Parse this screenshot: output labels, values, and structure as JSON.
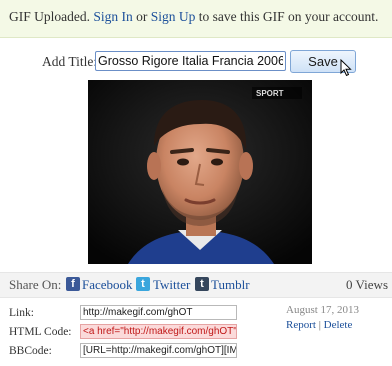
{
  "notice": {
    "status": "GIF Uploaded.",
    "sign_in": "Sign In",
    "or": "or",
    "sign_up": "Sign Up",
    "suffix": "to save this GIF on your account."
  },
  "title_form": {
    "label": "Add Title:",
    "value": "Grosso Rigore Italia Francia 2006",
    "save_label": "Save"
  },
  "gif": {
    "overlay": "SPORT"
  },
  "share": {
    "label": "Share On:",
    "facebook": "Facebook",
    "twitter": "Twitter",
    "tumblr": "Tumblr",
    "views": "0 Views"
  },
  "links": {
    "link_label": "Link:",
    "link_value": "http://makegif.com/ghOT",
    "html_label": "HTML Code:",
    "html_value": "<a href=\"http://makegif.com/ghOT\"><img src=\"http://makegif.com/ghOT.gif\" /></a>",
    "bb_label": "BBCode:",
    "bb_value": "[URL=http://makegif.com/ghOT][IMG]http://makegif.com/ghOT.gif[/IMG][/URL]"
  },
  "meta": {
    "date": "August 17, 2013",
    "report": "Report",
    "separator": "|",
    "delete": "Delete"
  },
  "colors": {
    "link": "#1b4f9a",
    "notice_bg": "#f4f9e6",
    "facebook": "#3b5998",
    "twitter": "#3aa6dd",
    "tumblr": "#35465c"
  }
}
